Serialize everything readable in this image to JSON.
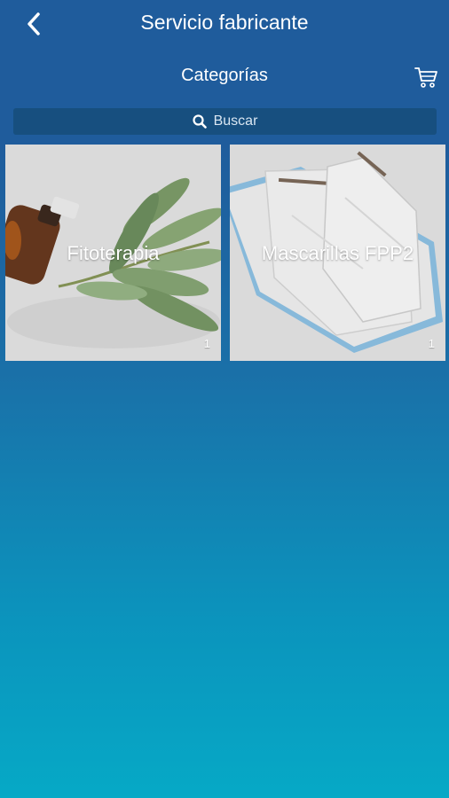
{
  "navbar": {
    "title": "Servicio fabricante",
    "back_icon": "chevron-left-icon"
  },
  "subbar": {
    "title": "Categorías",
    "cart_icon": "cart-icon"
  },
  "search": {
    "placeholder": "Buscar",
    "icon": "search-icon"
  },
  "categories": [
    {
      "label": "Fitoterapia",
      "count": "1"
    },
    {
      "label": "Mascarillas FPP2",
      "count": "1"
    }
  ],
  "colors": {
    "header": "#1f5c9c",
    "search_bg": "#174f7f",
    "bottom": "#06a9c6"
  }
}
